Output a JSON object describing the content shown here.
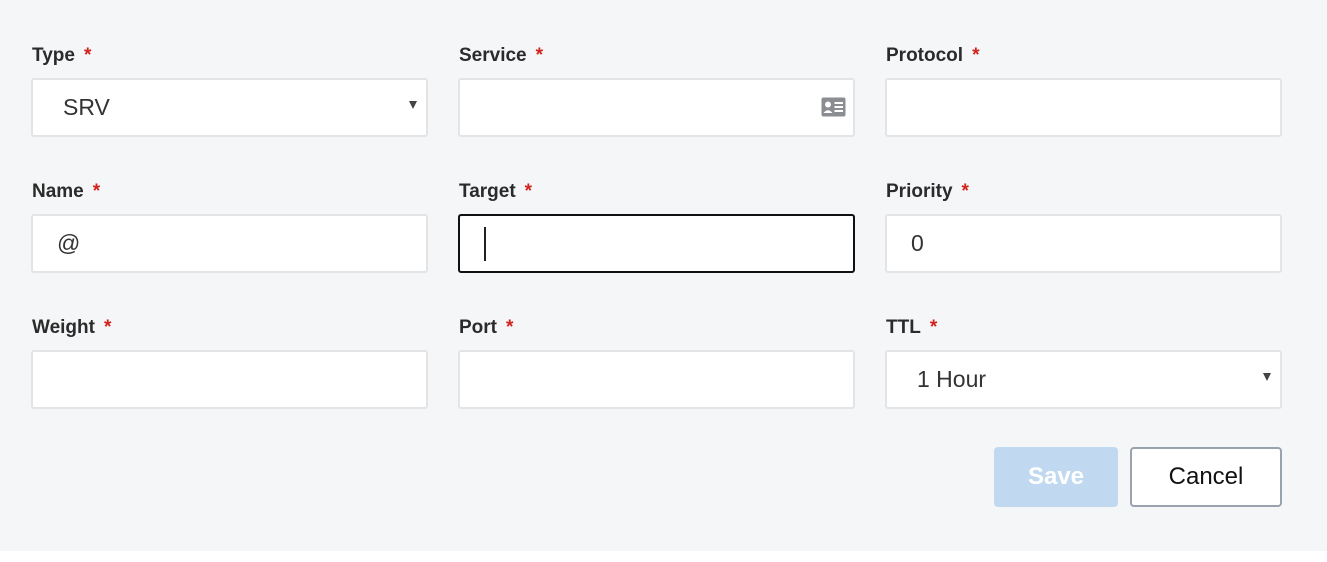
{
  "form": {
    "fields": {
      "type": {
        "label": "Type",
        "required_mark": "*",
        "value": "SRV"
      },
      "service": {
        "label": "Service",
        "required_mark": "*",
        "value": "",
        "icon": "contact-card-icon"
      },
      "protocol": {
        "label": "Protocol",
        "required_mark": "*",
        "value": ""
      },
      "name": {
        "label": "Name",
        "required_mark": "*",
        "value": "@"
      },
      "target": {
        "label": "Target",
        "required_mark": "*",
        "value": ""
      },
      "priority": {
        "label": "Priority",
        "required_mark": "*",
        "value": "0"
      },
      "weight": {
        "label": "Weight",
        "required_mark": "*",
        "value": ""
      },
      "port": {
        "label": "Port",
        "required_mark": "*",
        "value": ""
      },
      "ttl": {
        "label": "TTL",
        "required_mark": "*",
        "value": "1 Hour"
      }
    },
    "actions": {
      "save_label": "Save",
      "cancel_label": "Cancel"
    }
  },
  "colors": {
    "panel_background": "#f5f6f7",
    "required_marker": "#d0231d",
    "save_disabled_bg": "#c0d9f0",
    "focus_border": "#111111"
  }
}
